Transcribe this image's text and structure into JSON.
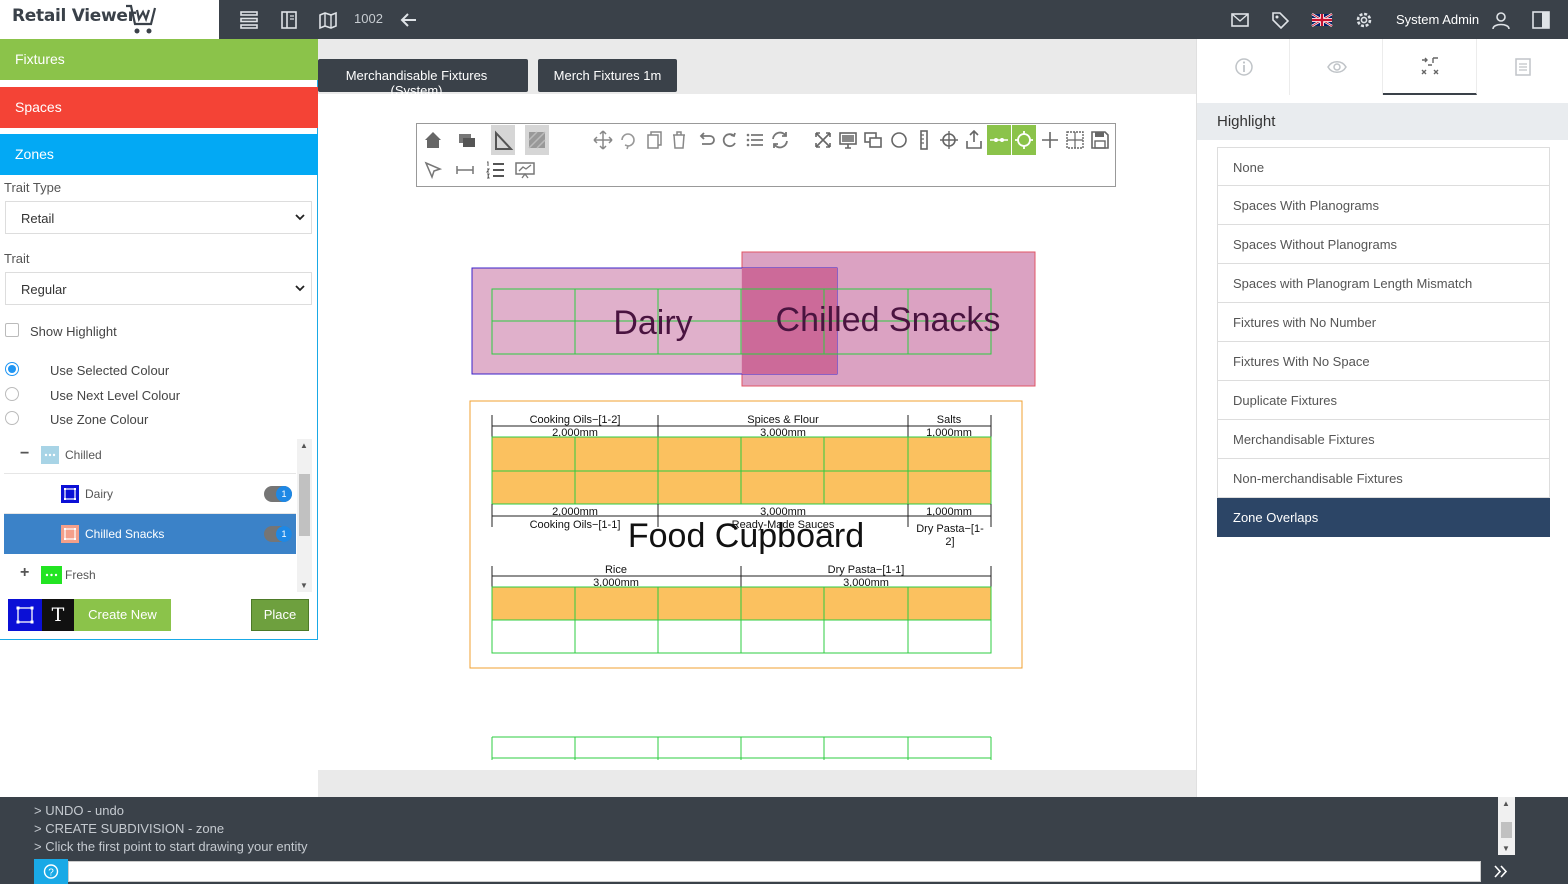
{
  "app": {
    "logo_text": "Retail Viewer"
  },
  "topbar": {
    "store_number": "1002",
    "user_name": "System Admin",
    "icons": [
      "layers-icon",
      "book-icon",
      "map-icon",
      "back-arrow-icon",
      "mail-icon",
      "tag-icon",
      "uk-flag-icon",
      "gear-icon",
      "user-icon",
      "panel-toggle-icon"
    ]
  },
  "left_panel": {
    "sections": {
      "fixtures": "Fixtures",
      "spaces": "Spaces",
      "zones": "Zones"
    },
    "trait_type": {
      "label": "Trait Type",
      "value": "Retail"
    },
    "trait": {
      "label": "Trait",
      "value": "Regular"
    },
    "show_highlight": {
      "label": "Show Highlight",
      "checked": false
    },
    "colour_options": [
      {
        "label": "Use Selected Colour",
        "selected": true
      },
      {
        "label": "Use Next Level Colour",
        "selected": false
      },
      {
        "label": "Use Zone Colour",
        "selected": false
      }
    ],
    "tree": [
      {
        "label": "Chilled",
        "toggle": "−",
        "color": "#a8d4e6",
        "level": 0
      },
      {
        "label": "Dairy",
        "color": "#0b10d6",
        "level": 1,
        "count": "1"
      },
      {
        "label": "Chilled Snacks",
        "color": "#f4a08a",
        "level": 1,
        "count": "1",
        "selected": true
      },
      {
        "label": "Fresh",
        "toggle": "+",
        "color": "#22e422",
        "level": 0
      }
    ],
    "buttons": {
      "text_tool": "T",
      "create_new": "Create New",
      "place": "Place"
    }
  },
  "canvas": {
    "tabs": [
      "Merchandisable Fixtures (System)",
      "Merch Fixtures 1m"
    ],
    "zone_labels": {
      "dairy": "Dairy",
      "chilled_snacks": "Chilled Snacks",
      "food_cupboard": "Food Cupboard"
    },
    "fixture_labels": {
      "top_row": [
        "Cooking Oils−[1-2]",
        "Spices & Flour",
        "Salts"
      ],
      "top_row_dims": [
        "2,000mm",
        "3,000mm",
        "1,000mm"
      ],
      "mid_row_dims": [
        "2,000mm",
        "3,000mm",
        "1,000mm"
      ],
      "mid_row": [
        "Cooking Oils−[1-1]",
        "Ready-Made Sauces",
        "Dry Pasta−[1-",
        "2]"
      ],
      "lower_row": [
        "Rice",
        "Dry Pasta−[1-1]"
      ],
      "lower_row_dims": [
        "3,000mm",
        "3,000mm"
      ]
    }
  },
  "right_panel": {
    "tabs": [
      "info-icon",
      "eye-icon",
      "zone-tools-icon",
      "document-icon"
    ],
    "active_tab": 2,
    "highlight_title": "Highlight",
    "highlight_options": [
      "None",
      "Spaces With Planograms",
      "Spaces Without Planograms",
      "Spaces with Planogram Length Mismatch",
      "Fixtures with No Number",
      "Fixtures With No Space",
      "Duplicate Fixtures",
      "Merchandisable Fixtures",
      "Non-merchandisable Fixtures",
      "Zone Overlaps"
    ],
    "active_option": "Zone Overlaps"
  },
  "console": {
    "lines": [
      "> UNDO - undo",
      "> CREATE SUBDIVISION - zone",
      "> Click the first point to start drawing your entity"
    ],
    "input_value": "",
    "help_label": "?"
  },
  "colors": {
    "topbar": "#3a4149",
    "fixtures": "#8bc34a",
    "spaces": "#f44336",
    "zones": "#03a9f4",
    "zone_fill": "#dba2c2",
    "space_fill": "#fbc15f",
    "grid_green": "#2ecc40",
    "active_highlight": "#2c4566"
  }
}
